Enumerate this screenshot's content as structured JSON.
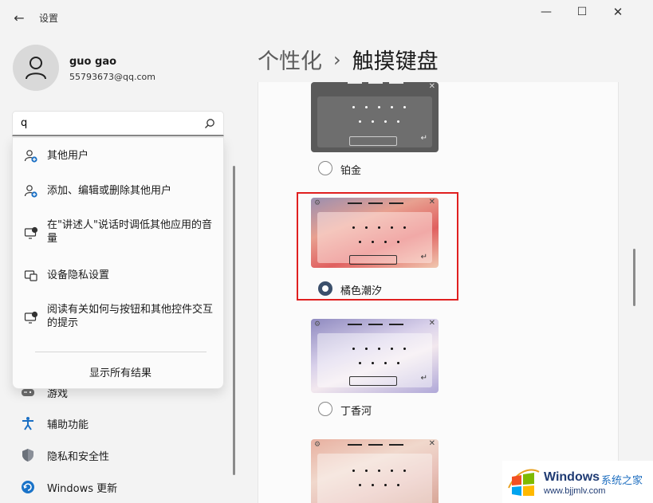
{
  "window": {
    "title": "设置",
    "back_glyph": "←",
    "minimize_glyph": "—",
    "maximize_glyph": "☐",
    "close_glyph": "✕"
  },
  "account": {
    "name": "guo gao",
    "email": "55793673@qq.com"
  },
  "search": {
    "value": "q",
    "results": [
      {
        "label": "其他用户",
        "icon": "person-add-icon"
      },
      {
        "label": "添加、编辑或删除其他用户",
        "icon": "person-add-icon"
      },
      {
        "label": "在\"讲述人\"说话时调低其他应用的音量",
        "icon": "narrator-icon"
      },
      {
        "label": "设备隐私设置",
        "icon": "device-privacy-icon"
      },
      {
        "label": "阅读有关如何与按钮和其他控件交互的提示",
        "icon": "narrator-icon"
      }
    ],
    "show_all": "显示所有结果"
  },
  "nav": [
    {
      "label": "游戏",
      "icon": "gamepad-icon"
    },
    {
      "label": "辅助功能",
      "icon": "accessibility-icon"
    },
    {
      "label": "隐私和安全性",
      "icon": "shield-icon"
    },
    {
      "label": "Windows 更新",
      "icon": "update-icon"
    }
  ],
  "header": {
    "parent": "个性化",
    "separator": "›",
    "current": "触摸键盘"
  },
  "themes": [
    {
      "label": "铂金",
      "selected": false
    },
    {
      "label": "橘色潮汐",
      "selected": true
    },
    {
      "label": "丁香河",
      "selected": false
    }
  ],
  "watermark": {
    "title": "Windows",
    "subtitle": "系统之家",
    "url": "www.bjjmlv.com"
  }
}
